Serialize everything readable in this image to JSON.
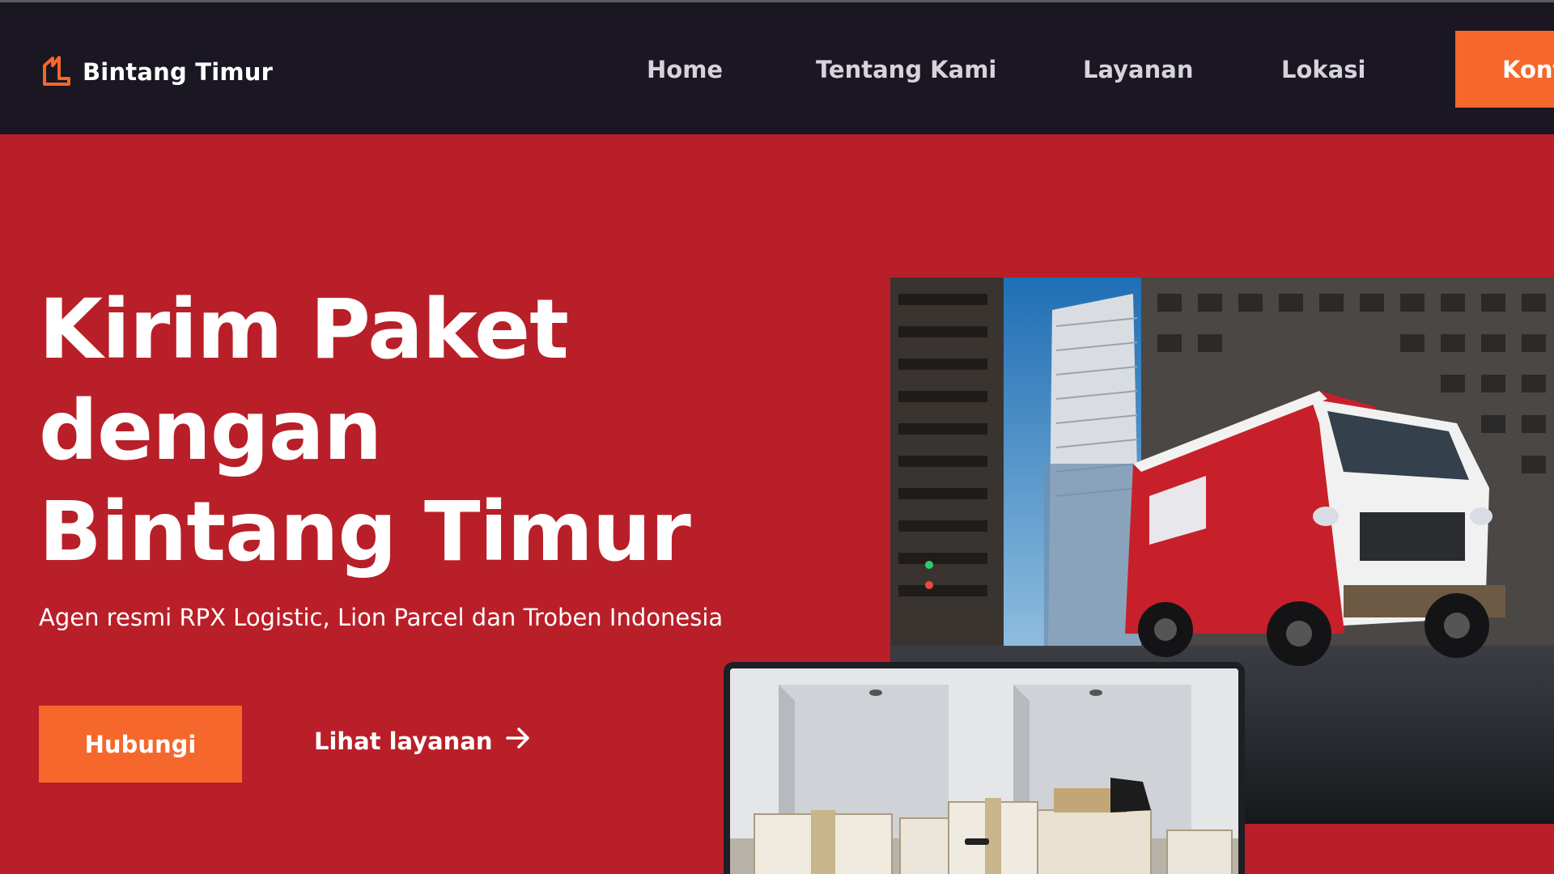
{
  "brand": {
    "name": "Bintang Timur",
    "accent_color": "#f5672a",
    "logo_icon": "house-outline-icon"
  },
  "nav": {
    "items": [
      {
        "label": "Home"
      },
      {
        "label": "Tentang Kami"
      },
      {
        "label": "Layanan"
      },
      {
        "label": "Lokasi"
      }
    ],
    "cta_label": "Kont"
  },
  "hero": {
    "title_lines": [
      "Kirim Paket",
      "dengan",
      "Bintang Timur"
    ],
    "subtitle": "Agen resmi RPX Logistic, Lion Parcel dan Troben Indonesia",
    "primary_button": "Hubungi",
    "secondary_link": "Lihat layanan",
    "secondary_icon": "arrow-right-icon",
    "background_color": "#b91f28"
  },
  "images": {
    "truck_photo": "delivery-truck-city-photo",
    "boxes_photo": "cardboard-boxes-room-photo"
  }
}
